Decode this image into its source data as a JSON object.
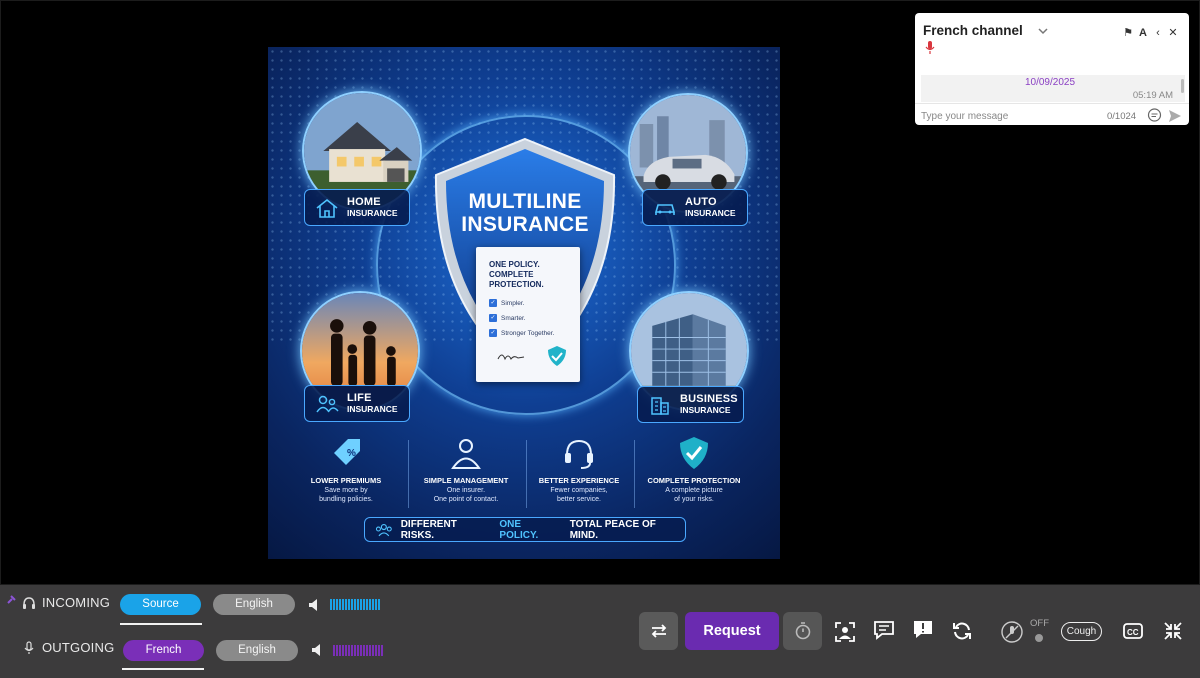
{
  "poster": {
    "title_line1": "MULTILINE",
    "title_line2": "INSURANCE",
    "doc_heading_line1": "ONE POLICY.",
    "doc_heading_line2": "COMPLETE",
    "doc_heading_line3": "PROTECTION.",
    "doc_checks": [
      "Simpler.",
      "Smarter.",
      "Stronger Together."
    ],
    "categories": {
      "home": {
        "line1": "HOME",
        "line2": "INSURANCE",
        "icon": "house-icon"
      },
      "auto": {
        "line1": "AUTO",
        "line2": "INSURANCE",
        "icon": "car-icon"
      },
      "life": {
        "line1": "LIFE",
        "line2": "INSURANCE",
        "icon": "people-icon"
      },
      "business": {
        "line1": "BUSINESS",
        "line2": "INSURANCE",
        "icon": "building-icon"
      }
    },
    "features": [
      {
        "title": "LOWER PREMIUMS",
        "desc1": "Save more by",
        "desc2": "bundling policies.",
        "icon": "percent-tag-icon"
      },
      {
        "title": "SIMPLE MANAGEMENT",
        "desc1": "One insurer.",
        "desc2": "One point of contact.",
        "icon": "person-icon"
      },
      {
        "title": "BETTER EXPERIENCE",
        "desc1": "Fewer companies,",
        "desc2": "better service.",
        "icon": "headset-icon"
      },
      {
        "title": "COMPLETE PROTECTION",
        "desc1": "A complete picture",
        "desc2": "of your risks.",
        "icon": "shield-check-icon"
      }
    ],
    "tagline": {
      "part1": "DIFFERENT RISKS.",
      "part2": "ONE POLICY.",
      "part3": "TOTAL PEACE OF MIND."
    }
  },
  "chat": {
    "title": "French channel",
    "date": "10/09/2025",
    "time": "05:19 AM",
    "input_placeholder": "Type your message",
    "char_count": "0/1024"
  },
  "controls": {
    "incoming_label": "INCOMING",
    "outgoing_label": "OUTGOING",
    "incoming_source": "Source",
    "incoming_target": "English",
    "outgoing_source": "French",
    "outgoing_target": "English",
    "request_label": "Request",
    "mic_state": "OFF",
    "cough_label": "Cough",
    "colors": {
      "source_pill": "#1aa3e8",
      "french_pill": "#7a2fb8",
      "request": "#6a2bb0",
      "bar_bg": "#3c3b3c"
    }
  }
}
